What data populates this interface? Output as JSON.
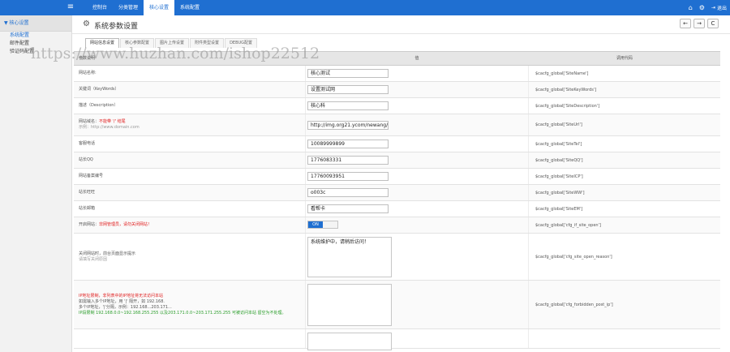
{
  "topbar": {
    "menu_icon": "hamburger-icon",
    "tabs": [
      "控制台",
      "分类管理",
      "核心设置",
      "系统配置"
    ],
    "active_tab": 2,
    "right_icons": [
      "home-icon",
      "gear-icon"
    ],
    "exit_label": "退出"
  },
  "sidebar": {
    "header": "▼ 核心设置",
    "items": [
      "系统配置",
      "邮件配置",
      "验证码配置"
    ]
  },
  "page": {
    "title": "系统参数设置",
    "nav_buttons": [
      "←",
      "→",
      "C"
    ]
  },
  "subtabs": [
    "网站信息设置",
    "核心参数配置",
    "图片上传设置",
    "附件类型设置",
    "DEBUG配置"
  ],
  "table": {
    "headers": [
      "参数说明",
      "值",
      "调用代码"
    ],
    "rows": [
      {
        "label": "网站名称:",
        "value": "核心测试",
        "code": "$cacfg_global['SiteName']"
      },
      {
        "label": "关键词（KeyWords）",
        "value": "设置测试网",
        "code": "$cacfg_global['SiteKeyWords']"
      },
      {
        "label": "描述（Description）",
        "value": "核心科",
        "code": "$cacfg_global['SiteDescription']"
      },
      {
        "label": "网站域名：",
        "label_red": "不能带 '/' 结尾",
        "sub": "示例：http://www.domain.com",
        "value": "http://img.org21.ycom/newang/t",
        "code": "$cacfg_global['SiteUrl']"
      },
      {
        "label": "客服电话",
        "value": "10089999899",
        "code": "$cacfg_global['SiteTel']"
      },
      {
        "label": "站长QQ",
        "value": "1776083331",
        "code": "$cacfg_global['SiteQQ']"
      },
      {
        "label": "网站备案编号",
        "value": "17760093951",
        "code": "$cacfg_global['SiteICP']"
      },
      {
        "label": "站长旺旺",
        "value": "o003c",
        "code": "$cacfg_global['SiteWW']"
      },
      {
        "label": "站长邮箱",
        "value": "看帮卡",
        "code": "$cacfg_global['SiteEM']"
      },
      {
        "label": "开启网站：",
        "label_red": "非网管理员，请勿关闭网站！",
        "toggle": "ON",
        "code": "$cacfg_global['cfg_if_site_open']"
      },
      {
        "label": "关闭网站时，前台页面显示提示",
        "sub": "请填写关闭原因",
        "value": "系统维护中，请稍后访问！",
        "code": "$cacfg_global['cfg_site_open_reason']"
      },
      {
        "lines": [
          "IP地址限制，非列表中的IP地址将无法访问本站",
          "如需输入多个IP地址，用 '|' 隔开，如 192.168.",
          "多个IP地址，'|'分隔，示例：192.168...203.171...",
          "IP段限制 192.168.0.0~192.168.255.255 以及203.171.0.0~203.171.255.255 可被访问本站 留空为不处理。"
        ],
        "value": "",
        "code": "$cacfg_global['cfg_forbidden_post_ip']"
      },
      {
        "label": "",
        "value": "",
        "code": ""
      }
    ]
  },
  "watermark": "https://www.huzhan.com/ishop22512"
}
